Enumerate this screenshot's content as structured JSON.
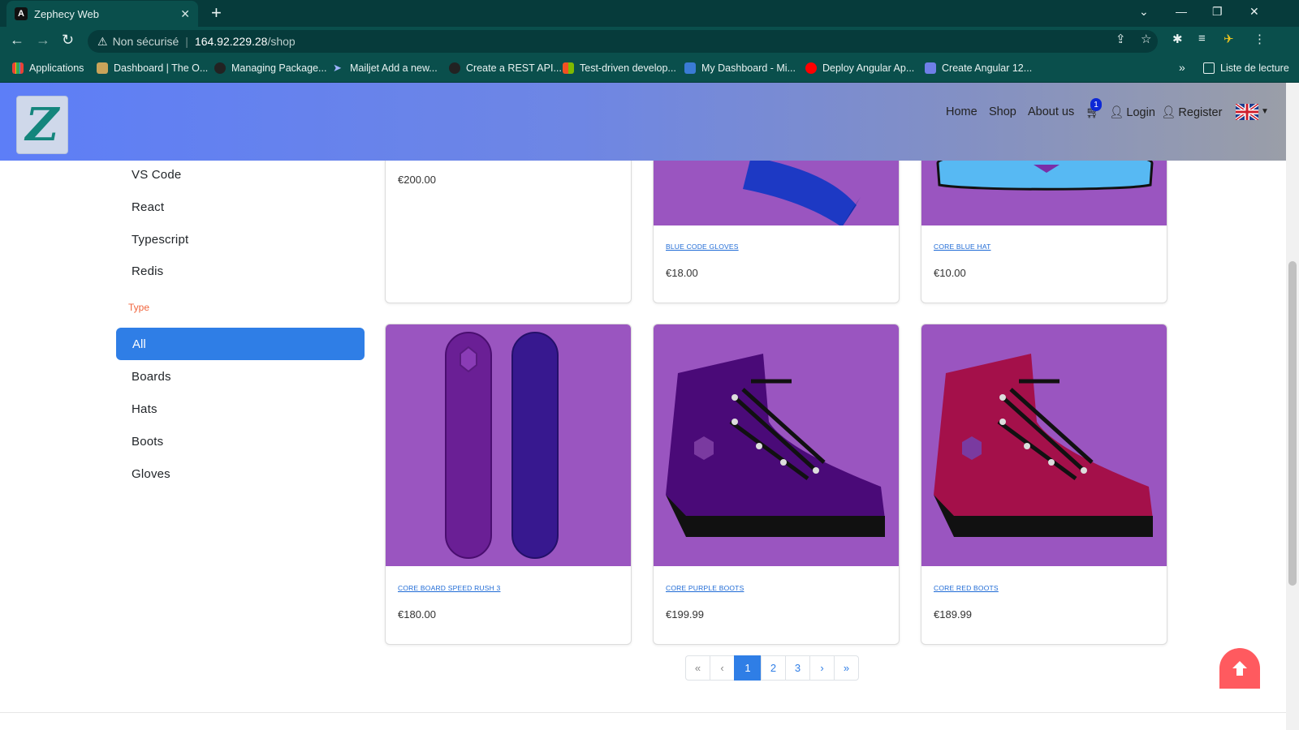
{
  "browser": {
    "tab_title": "Zephecy Web",
    "tab_favicon": "A",
    "new_tab": "+",
    "window_controls": [
      "⌄",
      "—",
      "❐",
      "✕"
    ],
    "nav": [
      "←",
      "→",
      "↻"
    ],
    "security_label": "Non sécurisé",
    "url_host": "164.92.229.28",
    "url_path": "/shop",
    "bookmarks": [
      {
        "label": "Applications"
      },
      {
        "label": "Dashboard | The O..."
      },
      {
        "label": "Managing Package..."
      },
      {
        "label": "Mailjet Add a new..."
      },
      {
        "label": "Create a REST API..."
      },
      {
        "label": "Test-driven develop..."
      },
      {
        "label": "My Dashboard - Mi..."
      },
      {
        "label": "Deploy Angular Ap..."
      },
      {
        "label": "Create Angular 12..."
      }
    ],
    "bookmarks_more": "»",
    "reading_list": "Liste de lecture"
  },
  "header": {
    "logo_letter": "Z",
    "nav": {
      "home": "Home",
      "shop": "Shop",
      "about": "About us",
      "cart_count": "1",
      "login": "Login",
      "register": "Register"
    }
  },
  "sidebar": {
    "tech_items": [
      "VS Code",
      "React",
      "Typescript",
      "Redis"
    ],
    "type_heading": "Type",
    "type_active": "All",
    "type_items": [
      "Boards",
      "Hats",
      "Boots",
      "Gloves"
    ]
  },
  "products": [
    {
      "name": "",
      "price": "€200.00"
    },
    {
      "name": "BLUE CODE GLOVES",
      "price": "€18.00"
    },
    {
      "name": "CORE BLUE HAT",
      "price": "€10.00"
    },
    {
      "name": "CORE BOARD SPEED RUSH 3",
      "price": "€180.00"
    },
    {
      "name": "CORE PURPLE BOOTS",
      "price": "€199.99"
    },
    {
      "name": "CORE RED BOOTS",
      "price": "€189.99"
    }
  ],
  "pagination": {
    "first": "«",
    "prev": "‹",
    "pages": [
      "1",
      "2",
      "3"
    ],
    "current": "1",
    "next": "›",
    "last": "»"
  },
  "colors": {
    "accent": "#2f7ee6",
    "product_bg": "#9a55c0",
    "to_top": "#ff5a5f",
    "type_heading": "#f0643c"
  }
}
